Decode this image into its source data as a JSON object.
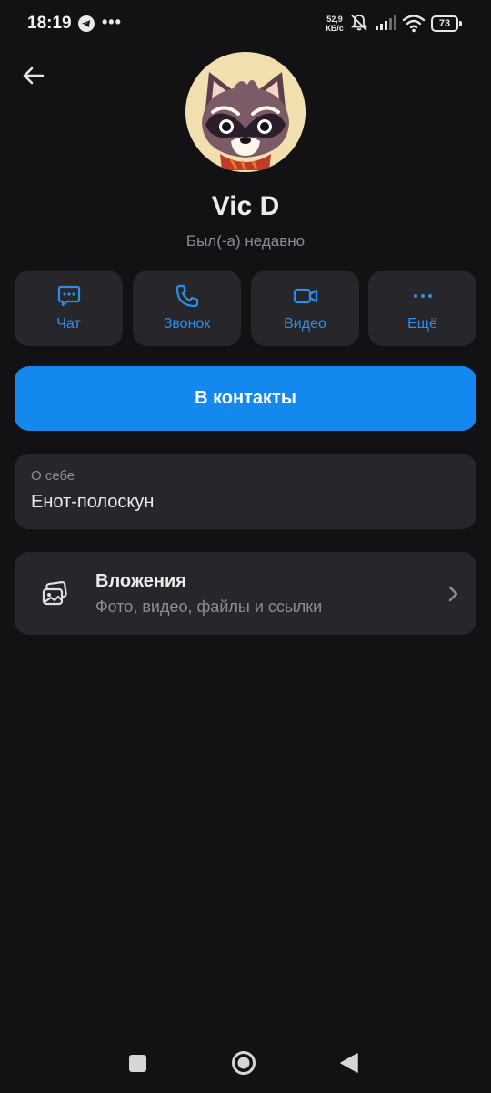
{
  "status_bar": {
    "time": "18:19",
    "network_speed_value": "52,9",
    "network_speed_unit": "КБ/с",
    "battery": "73"
  },
  "profile": {
    "name": "Vic D",
    "last_seen": "Был(-а) недавно"
  },
  "actions": [
    {
      "label": "Чат",
      "icon": "chat-icon"
    },
    {
      "label": "Звонок",
      "icon": "phone-icon"
    },
    {
      "label": "Видео",
      "icon": "video-icon"
    },
    {
      "label": "Ещё",
      "icon": "more-icon"
    }
  ],
  "add_contact_label": "В контакты",
  "about": {
    "label": "О себе",
    "value": "Енот-полоскун"
  },
  "attachments": {
    "title": "Вложения",
    "subtitle": "Фото, видео, файлы и ссылки"
  },
  "colors": {
    "background": "#121215",
    "card": "#26262b",
    "accent": "#1389f0",
    "accent_text": "#2b8fe8",
    "secondary_text": "#8d8d94"
  }
}
